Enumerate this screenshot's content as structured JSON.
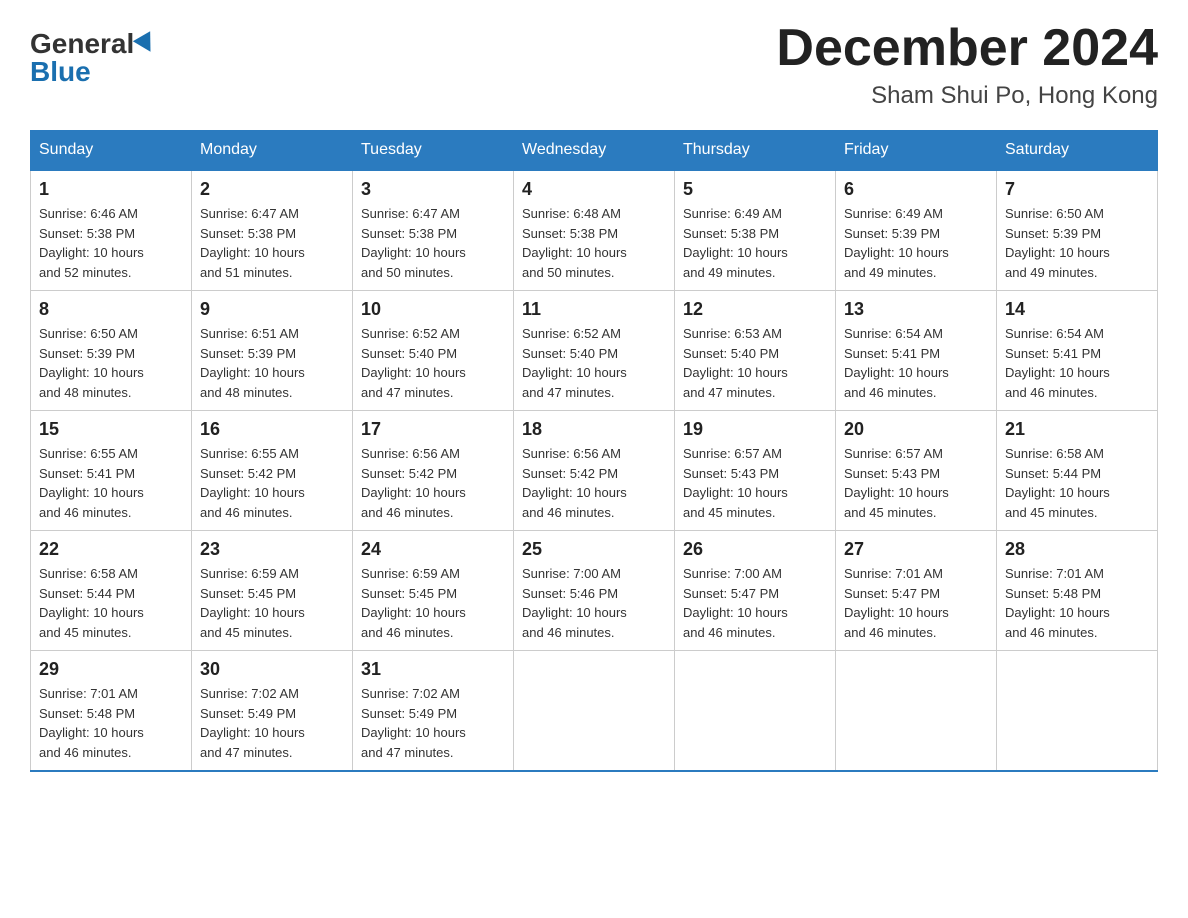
{
  "header": {
    "logo_general": "General",
    "logo_blue": "Blue",
    "month_title": "December 2024",
    "location": "Sham Shui Po, Hong Kong"
  },
  "days_of_week": [
    "Sunday",
    "Monday",
    "Tuesday",
    "Wednesday",
    "Thursday",
    "Friday",
    "Saturday"
  ],
  "weeks": [
    [
      {
        "day": "1",
        "sunrise": "6:46 AM",
        "sunset": "5:38 PM",
        "daylight": "10 hours and 52 minutes."
      },
      {
        "day": "2",
        "sunrise": "6:47 AM",
        "sunset": "5:38 PM",
        "daylight": "10 hours and 51 minutes."
      },
      {
        "day": "3",
        "sunrise": "6:47 AM",
        "sunset": "5:38 PM",
        "daylight": "10 hours and 50 minutes."
      },
      {
        "day": "4",
        "sunrise": "6:48 AM",
        "sunset": "5:38 PM",
        "daylight": "10 hours and 50 minutes."
      },
      {
        "day": "5",
        "sunrise": "6:49 AM",
        "sunset": "5:38 PM",
        "daylight": "10 hours and 49 minutes."
      },
      {
        "day": "6",
        "sunrise": "6:49 AM",
        "sunset": "5:39 PM",
        "daylight": "10 hours and 49 minutes."
      },
      {
        "day": "7",
        "sunrise": "6:50 AM",
        "sunset": "5:39 PM",
        "daylight": "10 hours and 49 minutes."
      }
    ],
    [
      {
        "day": "8",
        "sunrise": "6:50 AM",
        "sunset": "5:39 PM",
        "daylight": "10 hours and 48 minutes."
      },
      {
        "day": "9",
        "sunrise": "6:51 AM",
        "sunset": "5:39 PM",
        "daylight": "10 hours and 48 minutes."
      },
      {
        "day": "10",
        "sunrise": "6:52 AM",
        "sunset": "5:40 PM",
        "daylight": "10 hours and 47 minutes."
      },
      {
        "day": "11",
        "sunrise": "6:52 AM",
        "sunset": "5:40 PM",
        "daylight": "10 hours and 47 minutes."
      },
      {
        "day": "12",
        "sunrise": "6:53 AM",
        "sunset": "5:40 PM",
        "daylight": "10 hours and 47 minutes."
      },
      {
        "day": "13",
        "sunrise": "6:54 AM",
        "sunset": "5:41 PM",
        "daylight": "10 hours and 46 minutes."
      },
      {
        "day": "14",
        "sunrise": "6:54 AM",
        "sunset": "5:41 PM",
        "daylight": "10 hours and 46 minutes."
      }
    ],
    [
      {
        "day": "15",
        "sunrise": "6:55 AM",
        "sunset": "5:41 PM",
        "daylight": "10 hours and 46 minutes."
      },
      {
        "day": "16",
        "sunrise": "6:55 AM",
        "sunset": "5:42 PM",
        "daylight": "10 hours and 46 minutes."
      },
      {
        "day": "17",
        "sunrise": "6:56 AM",
        "sunset": "5:42 PM",
        "daylight": "10 hours and 46 minutes."
      },
      {
        "day": "18",
        "sunrise": "6:56 AM",
        "sunset": "5:42 PM",
        "daylight": "10 hours and 46 minutes."
      },
      {
        "day": "19",
        "sunrise": "6:57 AM",
        "sunset": "5:43 PM",
        "daylight": "10 hours and 45 minutes."
      },
      {
        "day": "20",
        "sunrise": "6:57 AM",
        "sunset": "5:43 PM",
        "daylight": "10 hours and 45 minutes."
      },
      {
        "day": "21",
        "sunrise": "6:58 AM",
        "sunset": "5:44 PM",
        "daylight": "10 hours and 45 minutes."
      }
    ],
    [
      {
        "day": "22",
        "sunrise": "6:58 AM",
        "sunset": "5:44 PM",
        "daylight": "10 hours and 45 minutes."
      },
      {
        "day": "23",
        "sunrise": "6:59 AM",
        "sunset": "5:45 PM",
        "daylight": "10 hours and 45 minutes."
      },
      {
        "day": "24",
        "sunrise": "6:59 AM",
        "sunset": "5:45 PM",
        "daylight": "10 hours and 46 minutes."
      },
      {
        "day": "25",
        "sunrise": "7:00 AM",
        "sunset": "5:46 PM",
        "daylight": "10 hours and 46 minutes."
      },
      {
        "day": "26",
        "sunrise": "7:00 AM",
        "sunset": "5:47 PM",
        "daylight": "10 hours and 46 minutes."
      },
      {
        "day": "27",
        "sunrise": "7:01 AM",
        "sunset": "5:47 PM",
        "daylight": "10 hours and 46 minutes."
      },
      {
        "day": "28",
        "sunrise": "7:01 AM",
        "sunset": "5:48 PM",
        "daylight": "10 hours and 46 minutes."
      }
    ],
    [
      {
        "day": "29",
        "sunrise": "7:01 AM",
        "sunset": "5:48 PM",
        "daylight": "10 hours and 46 minutes."
      },
      {
        "day": "30",
        "sunrise": "7:02 AM",
        "sunset": "5:49 PM",
        "daylight": "10 hours and 47 minutes."
      },
      {
        "day": "31",
        "sunrise": "7:02 AM",
        "sunset": "5:49 PM",
        "daylight": "10 hours and 47 minutes."
      },
      null,
      null,
      null,
      null
    ]
  ],
  "labels": {
    "sunrise": "Sunrise:",
    "sunset": "Sunset:",
    "daylight": "Daylight:"
  }
}
